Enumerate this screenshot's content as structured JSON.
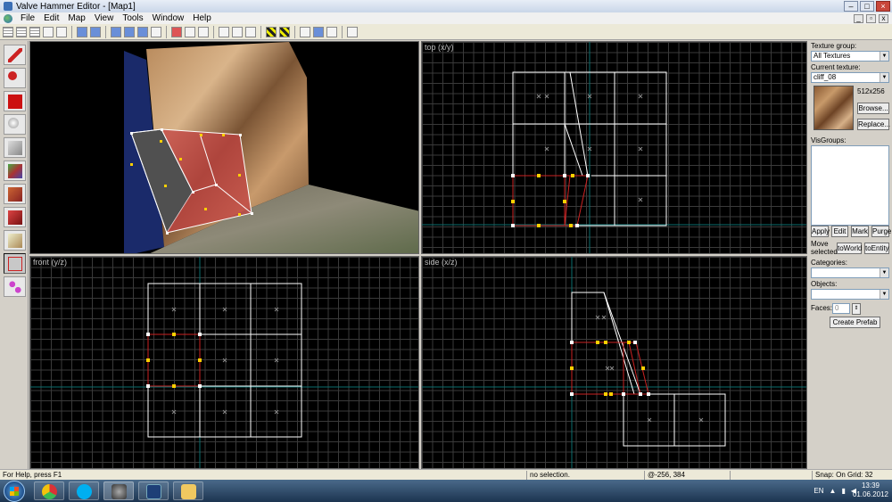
{
  "window": {
    "title": "Valve Hammer Editor - [Map1]"
  },
  "menu": [
    "File",
    "Edit",
    "Map",
    "View",
    "Tools",
    "Window",
    "Help"
  ],
  "viewports": {
    "top": "top (x/y)",
    "front": "front (y/z)",
    "side": "side (x/z)"
  },
  "panel": {
    "texture_group_label": "Texture group:",
    "texture_group_value": "All Textures",
    "current_texture_label": "Current texture:",
    "current_texture_value": "cliff_08",
    "texture_size": "512x256",
    "browse": "Browse...",
    "replace": "Replace...",
    "visgroups_label": "VisGroups:",
    "apply": "Apply",
    "edit": "Edit",
    "mark": "Mark",
    "purge": "Purge",
    "move_selected_label": "Move selected:",
    "to_world": "toWorld",
    "to_entity": "toEntity",
    "categories_label": "Categories:",
    "objects_label": "Objects:",
    "faces_label": "Faces:",
    "faces_value": "0",
    "create_prefab": "Create Prefab"
  },
  "status": {
    "help": "For Help, press F1",
    "selection": "no selection.",
    "coords": "@-256, 384",
    "snap": "Snap: On Grid: 32"
  },
  "taskbar": {
    "lang": "EN",
    "time": "13:39",
    "date": "01.06.2012"
  }
}
